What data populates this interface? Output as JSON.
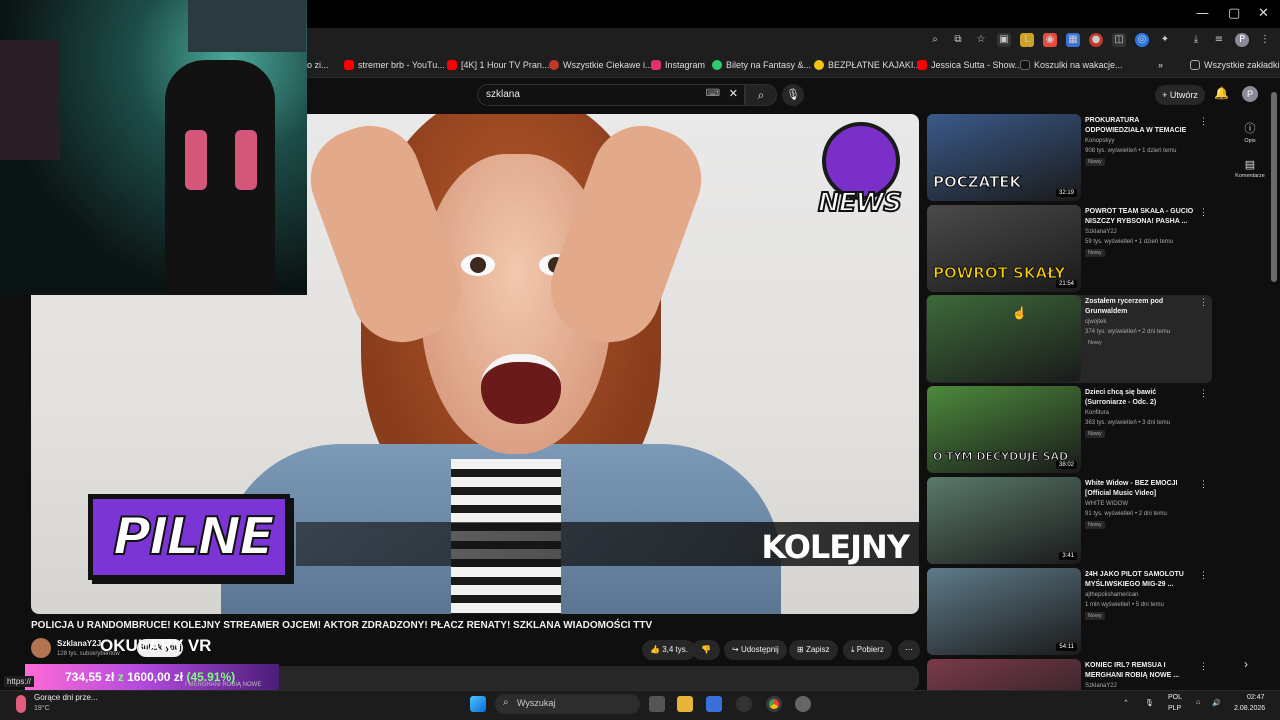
{
  "browser": {
    "window_controls": [
      "—",
      "▢",
      "✕"
    ],
    "bookmarks": [
      {
        "label": "lo zi...",
        "color": "#888888"
      },
      {
        "label": "stremer brb - YouTu...",
        "color": "#ff0000"
      },
      {
        "label": "[4K] 1 Hour TV Pran...",
        "color": "#ff0000"
      },
      {
        "label": "Wszystkie Ciekawe i...",
        "color": "#c0392b"
      },
      {
        "label": "Instagram",
        "color": "#e1306c"
      },
      {
        "label": "Bilety na Fantasy &...",
        "color": "#2ecc71"
      },
      {
        "label": "BEZPŁATNE KAJAKI...",
        "color": "#f1c40f"
      },
      {
        "label": "Jessica Sutta - Show...",
        "color": "#ff0000"
      },
      {
        "label": "Koszulki na wakacje...",
        "color": "#111111"
      }
    ],
    "all_bookmarks": "Wszystkie zakładki",
    "profile_initial": "P",
    "status_url": "https://"
  },
  "youtube": {
    "search_query": "szklana",
    "create_label": "Utwórz",
    "avatar_initial": "P"
  },
  "video": {
    "title": "POLICJA U RANDOMBRUCE! KOLEJNY STREAMER OJCEM! AKTOR ZDRADZONY! PŁACZ RENATY! SZKLANA WIADOMOŚCI TTV",
    "thumbnail_badge": "PILNE",
    "thumbnail_ticker": "KOLEJNY",
    "logo_word": "NEWS",
    "channel_name": "SzklanaY2J",
    "subscribers": "128 tys. subskrybentów",
    "subscribe_label": "Subskrybuj",
    "likes": "3,4 tys.",
    "share_label": "Udostępnij",
    "save_label": "Zapisz",
    "download_label": "Pobierz"
  },
  "overlay": {
    "big_text": "OKULARY VR",
    "donation_current": "734,55 zł",
    "donation_sep": "z",
    "donation_goal": "1600,00 zł",
    "donation_percent": "(45.91%)",
    "donation_sub": "I MERGHANI ROBIĄ NOWE"
  },
  "sidebar": {
    "rail": [
      {
        "icon": "ⓘ",
        "label": "Opis"
      },
      {
        "icon": "▤",
        "label": "Komentarze"
      }
    ],
    "recommendations": [
      {
        "title": "PROKURATURA ODPOWIEDZIAŁA W TEMACIE FAGATY (DŻORDŻO, ...",
        "channel": "Konopskyy",
        "meta": "908 tys. wyświetleń • 1 dzień temu",
        "badge": "Nowy",
        "duration": "32:19",
        "caption": "POCZĄTEK",
        "thumb_color": "#3a5a8a"
      },
      {
        "title": "POWRÓT TEAM SKAŁA - GUCIO NISZCZY RYBSONA! PASHA ...",
        "channel": "SzklanaY2J",
        "meta": "59 tys. wyświetleń • 1 dzień temu",
        "badge": "Nowy",
        "duration": "21:54",
        "caption": "POWRÓT SKAŁY",
        "thumb_color": "#4a4a4a"
      },
      {
        "title": "Zostałem rycerzem pod Grunwaldem",
        "channel": "cjwojtek",
        "meta": "374 tys. wyświetleń • 2 dni temu",
        "badge": "Nowy",
        "duration": "",
        "caption": "",
        "thumb_color": "#3d6a3a"
      },
      {
        "title": "Dzieci chcą się bawić (Surroniarze - Odc. 2)",
        "channel": "Konfitura",
        "meta": "363 tys. wyświetleń • 3 dni temu",
        "badge": "Nowy",
        "duration": "38:02",
        "caption": "O TYM DECYDUJE SĄD",
        "thumb_color": "#4c8a3c"
      },
      {
        "title": "White Widow - BEZ EMOCJI [Official Music Video]",
        "channel": "WHITE WIDOW",
        "meta": "91 tys. wyświetleń • 2 dni temu",
        "badge": "Nowy",
        "duration": "3:41",
        "caption": "",
        "thumb_color": "#5a7a6a"
      },
      {
        "title": "24H JAKO PILOT SAMOLOTU MYŚLIWSKIEGO MIG-29 ...",
        "channel": "ajthepolishamerican",
        "meta": "1 mln wyświetleń • 5 dni temu",
        "badge": "Nowy",
        "duration": "54:11",
        "caption": "",
        "thumb_color": "#5f7b8a"
      },
      {
        "title": "KONIEC IRL? REMSUA I MERGHANI ROBIĄ NOWE ...",
        "channel": "SzklanaY2J",
        "meta": "",
        "badge": "",
        "duration": "",
        "caption": "",
        "thumb_color": "#7a3a4a"
      }
    ]
  },
  "taskbar": {
    "weather_title": "Gorące dni prze...",
    "weather_temp": "19°C",
    "search_placeholder": "Wyszukaj",
    "lang_1": "POL",
    "lang_2": "PLP",
    "time": "02:47",
    "date": "2.08.2026"
  }
}
